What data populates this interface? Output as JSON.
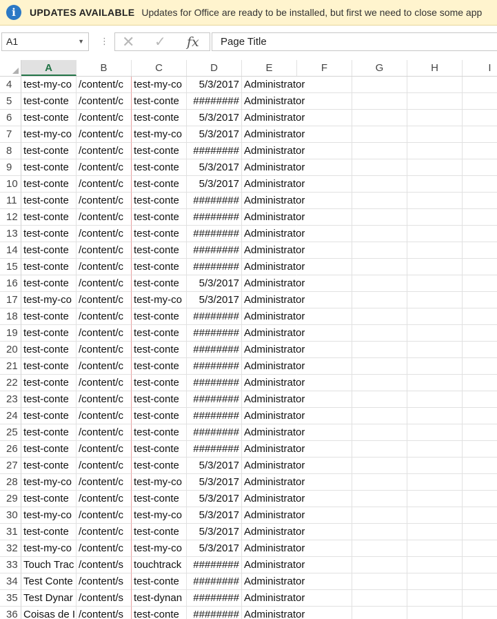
{
  "update_bar": {
    "icon": "info-icon",
    "title": "UPDATES AVAILABLE",
    "message": "Updates for Office are ready to be installed, but first we need to close some app"
  },
  "formula_bar": {
    "name_box": "A1",
    "cancel_icon": "✕",
    "enter_icon": "✓",
    "function_icon": "fx",
    "dots": "⋮",
    "formula": "Page Title"
  },
  "columns": [
    "A",
    "B",
    "C",
    "D",
    "E",
    "F",
    "G",
    "H",
    "I"
  ],
  "active_column": "A",
  "rows": [
    {
      "n": "4",
      "a": "test-my-co",
      "b": "/content/c",
      "c": "test-my-co",
      "d": "5/3/2017",
      "e": "Administrator"
    },
    {
      "n": "5",
      "a": "test-conte",
      "b": "/content/c",
      "c": "test-conte",
      "d": "########",
      "e": "Administrator"
    },
    {
      "n": "6",
      "a": "test-conte",
      "b": "/content/c",
      "c": "test-conte",
      "d": "5/3/2017",
      "e": "Administrator"
    },
    {
      "n": "7",
      "a": "test-my-co",
      "b": "/content/c",
      "c": "test-my-co",
      "d": "5/3/2017",
      "e": "Administrator"
    },
    {
      "n": "8",
      "a": "test-conte",
      "b": "/content/c",
      "c": "test-conte",
      "d": "########",
      "e": "Administrator"
    },
    {
      "n": "9",
      "a": "test-conte",
      "b": "/content/c",
      "c": "test-conte",
      "d": "5/3/2017",
      "e": "Administrator"
    },
    {
      "n": "10",
      "a": "test-conte",
      "b": "/content/c",
      "c": "test-conte",
      "d": "5/3/2017",
      "e": "Administrator"
    },
    {
      "n": "11",
      "a": "test-conte",
      "b": "/content/c",
      "c": "test-conte",
      "d": "########",
      "e": "Administrator"
    },
    {
      "n": "12",
      "a": "test-conte",
      "b": "/content/c",
      "c": "test-conte",
      "d": "########",
      "e": "Administrator"
    },
    {
      "n": "13",
      "a": "test-conte",
      "b": "/content/c",
      "c": "test-conte",
      "d": "########",
      "e": "Administrator"
    },
    {
      "n": "14",
      "a": "test-conte",
      "b": "/content/c",
      "c": "test-conte",
      "d": "########",
      "e": "Administrator"
    },
    {
      "n": "15",
      "a": "test-conte",
      "b": "/content/c",
      "c": "test-conte",
      "d": "########",
      "e": "Administrator"
    },
    {
      "n": "16",
      "a": "test-conte",
      "b": "/content/c",
      "c": "test-conte",
      "d": "5/3/2017",
      "e": "Administrator"
    },
    {
      "n": "17",
      "a": "test-my-co",
      "b": "/content/c",
      "c": "test-my-co",
      "d": "5/3/2017",
      "e": "Administrator"
    },
    {
      "n": "18",
      "a": "test-conte",
      "b": "/content/c",
      "c": "test-conte",
      "d": "########",
      "e": "Administrator"
    },
    {
      "n": "19",
      "a": "test-conte",
      "b": "/content/c",
      "c": "test-conte",
      "d": "########",
      "e": "Administrator"
    },
    {
      "n": "20",
      "a": "test-conte",
      "b": "/content/c",
      "c": "test-conte",
      "d": "########",
      "e": "Administrator"
    },
    {
      "n": "21",
      "a": "test-conte",
      "b": "/content/c",
      "c": "test-conte",
      "d": "########",
      "e": "Administrator"
    },
    {
      "n": "22",
      "a": "test-conte",
      "b": "/content/c",
      "c": "test-conte",
      "d": "########",
      "e": "Administrator"
    },
    {
      "n": "23",
      "a": "test-conte",
      "b": "/content/c",
      "c": "test-conte",
      "d": "########",
      "e": "Administrator"
    },
    {
      "n": "24",
      "a": "test-conte",
      "b": "/content/c",
      "c": "test-conte",
      "d": "########",
      "e": "Administrator"
    },
    {
      "n": "25",
      "a": "test-conte",
      "b": "/content/c",
      "c": "test-conte",
      "d": "########",
      "e": "Administrator"
    },
    {
      "n": "26",
      "a": "test-conte",
      "b": "/content/c",
      "c": "test-conte",
      "d": "########",
      "e": "Administrator"
    },
    {
      "n": "27",
      "a": "test-conte",
      "b": "/content/c",
      "c": "test-conte",
      "d": "5/3/2017",
      "e": "Administrator"
    },
    {
      "n": "28",
      "a": "test-my-co",
      "b": "/content/c",
      "c": "test-my-co",
      "d": "5/3/2017",
      "e": "Administrator"
    },
    {
      "n": "29",
      "a": "test-conte",
      "b": "/content/c",
      "c": "test-conte",
      "d": "5/3/2017",
      "e": "Administrator"
    },
    {
      "n": "30",
      "a": "test-my-co",
      "b": "/content/c",
      "c": "test-my-co",
      "d": "5/3/2017",
      "e": "Administrator"
    },
    {
      "n": "31",
      "a": "test-conte",
      "b": "/content/c",
      "c": "test-conte",
      "d": "5/3/2017",
      "e": "Administrator"
    },
    {
      "n": "32",
      "a": "test-my-co",
      "b": "/content/c",
      "c": "test-my-co",
      "d": "5/3/2017",
      "e": "Administrator"
    },
    {
      "n": "33",
      "a": "Touch Trac",
      "b": "/content/s",
      "c": "touchtrack",
      "d": "########",
      "e": "Administrator"
    },
    {
      "n": "34",
      "a": "Test Conte",
      "b": "/content/s",
      "c": "test-conte",
      "d": "########",
      "e": "Administrator"
    },
    {
      "n": "35",
      "a": "Test Dynar",
      "b": "/content/s",
      "c": "test-dynan",
      "d": "########",
      "e": "Administrator"
    },
    {
      "n": "36",
      "a": "Coisas de I",
      "b": "/content/s",
      "c": "test-conte",
      "d": "########",
      "e": "Administrator"
    }
  ]
}
